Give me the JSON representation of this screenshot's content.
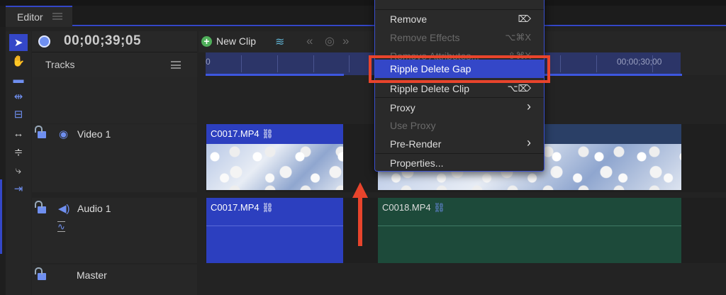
{
  "tab": {
    "label": "Editor"
  },
  "timecode": "00;00;39;05",
  "tracks_header": "Tracks",
  "toolbar": {
    "new_clip": "New Clip"
  },
  "ruler": {
    "start": "0",
    "mark": "00;00;30;00"
  },
  "tracks": [
    {
      "name": "Video 1",
      "clips": [
        "C0017.MP4",
        "C0018.MP4"
      ]
    },
    {
      "name": "Audio 1",
      "clips": [
        "C0017.MP4",
        "C0018.MP4"
      ]
    },
    {
      "name": "Master"
    }
  ],
  "menu": {
    "items": [
      {
        "label": "Remove",
        "shortcut": "⌦",
        "disabled": false
      },
      {
        "label": "Remove Effects",
        "shortcut": "⌥⌘X",
        "disabled": true
      },
      {
        "label": "Remove Attributes...",
        "shortcut": "⇧⌘X",
        "disabled": true
      },
      {
        "label": "Ripple Delete Gap",
        "shortcut": "",
        "highlighted": true
      },
      {
        "label": "Ripple Delete Clip",
        "shortcut": "⌥⌦"
      },
      {
        "label": "Proxy",
        "submenu": true,
        "arrow": "›"
      },
      {
        "label": "Use Proxy",
        "disabled": true
      },
      {
        "label": "Pre-Render",
        "submenu": true,
        "arrow": "›"
      },
      {
        "label": "Properties..."
      }
    ]
  },
  "colors": {
    "accent": "#3447c8",
    "annotation": "#e8442c",
    "audio_clip": "#1d4a3a"
  }
}
